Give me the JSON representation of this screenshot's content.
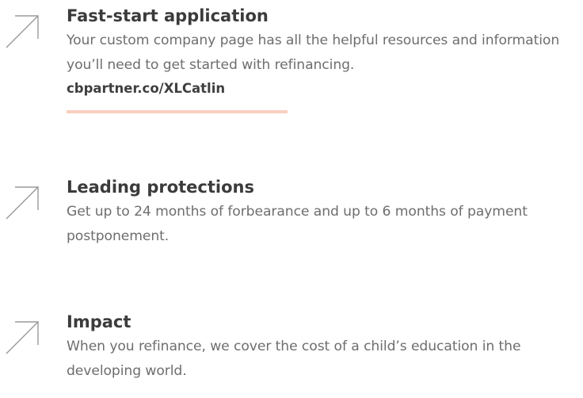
{
  "features": [
    {
      "icon": "arrow-up-right-icon",
      "title": "Fast-start application",
      "description": "Your custom company page has all the helpful resources and information you’ll need to get started with refinancing.",
      "link_text": "cbpartner.co/XLCatlin"
    },
    {
      "icon": "arrow-up-right-icon",
      "title": "Leading protections",
      "description": "Get up to 24 months of forbearance and up to 6 months of payment postponement."
    },
    {
      "icon": "arrow-up-right-icon",
      "title": "Impact",
      "description": "When you refinance, we cover the cost of a child’s education in the developing world."
    }
  ],
  "colors": {
    "title": "#3b3b3b",
    "description": "#6e6e6e",
    "icon": "#9a9a9a",
    "link_underline": "#f9cfc0"
  }
}
